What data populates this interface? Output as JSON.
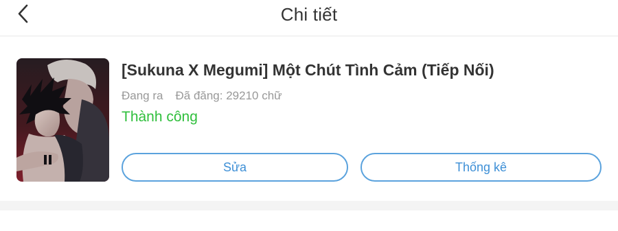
{
  "header": {
    "back_icon": "chevron-left-icon",
    "title": "Chi tiết"
  },
  "story": {
    "title": "[Sukuna X Megumi] Một Chút Tình Cảm (Tiếp Nối)",
    "status": "Đang ra",
    "word_count": "Đã đăng: 29210 chữ",
    "result": "Thành công",
    "cover_alt": "anime illustration cover"
  },
  "actions": {
    "edit_label": "Sửa",
    "stats_label": "Thống kê"
  },
  "colors": {
    "accent": "#5aa2dd",
    "success": "#2fbf3c",
    "title_text": "#333333",
    "muted_text": "#999999"
  }
}
